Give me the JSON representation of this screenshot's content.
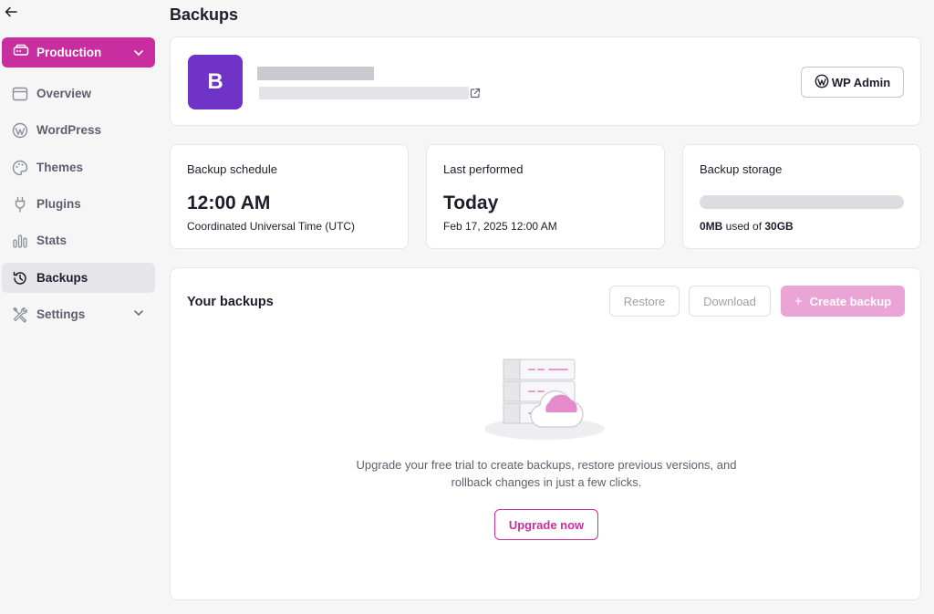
{
  "sidebar": {
    "environment": "Production",
    "items": [
      {
        "label": "Overview",
        "icon": "window-icon"
      },
      {
        "label": "WordPress",
        "icon": "wordpress-icon"
      },
      {
        "label": "Themes",
        "icon": "palette-icon"
      },
      {
        "label": "Plugins",
        "icon": "plug-icon"
      },
      {
        "label": "Stats",
        "icon": "bar-chart-icon"
      },
      {
        "label": "Backups",
        "icon": "history-icon",
        "active": true
      },
      {
        "label": "Settings",
        "icon": "tools-icon"
      }
    ]
  },
  "page": {
    "title": "Backups"
  },
  "site": {
    "initial": "B",
    "wp_admin_label": "WP Admin"
  },
  "schedule": {
    "label": "Backup schedule",
    "time": "12:00 AM",
    "timezone": "Coordinated Universal Time (UTC)"
  },
  "last_performed": {
    "label": "Last performed",
    "value": "Today",
    "date": "Feb 17, 2025 12:00 AM"
  },
  "storage": {
    "label": "Backup storage",
    "used": "0MB",
    "used_of": " used of ",
    "total": "30GB",
    "used_fraction": 0
  },
  "backups": {
    "title": "Your backups",
    "restore_label": "Restore",
    "download_label": "Download",
    "create_label": "Create backup",
    "empty_message": "Upgrade your free trial to create backups, restore previous versions, and rollback changes in just a few clicks.",
    "upgrade_label": "Upgrade now"
  },
  "colors": {
    "brand": "#c82e9f",
    "brand_light": "#eba4d6",
    "avatar": "#6f33c7"
  }
}
